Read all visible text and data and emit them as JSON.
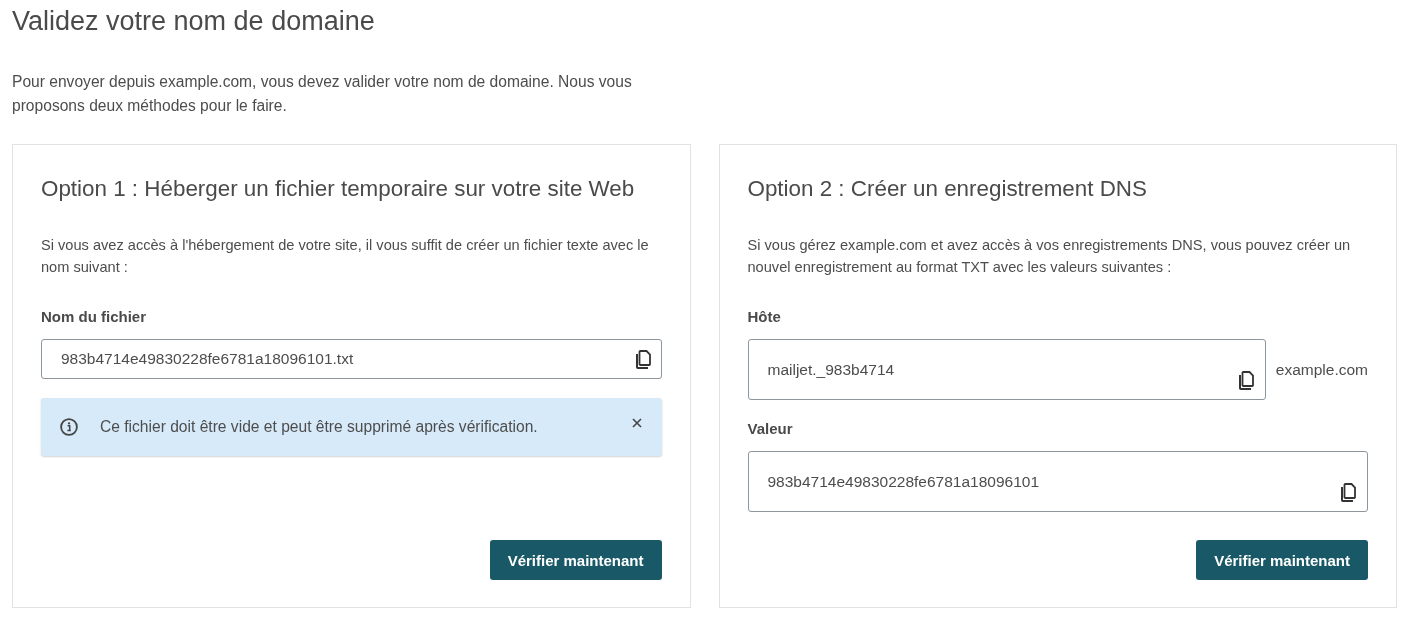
{
  "page": {
    "title": "Validez votre nom de domaine",
    "intro": "Pour envoyer depuis example.com, vous devez valider votre nom de domaine. Nous vous proposons deux méthodes pour le faire."
  },
  "options": [
    {
      "title": "Option 1 : Héberger un fichier temporaire sur votre site Web",
      "description": "Si vous avez accès à l'hébergement de votre site, il vous suffit de créer un fichier texte avec le nom suivant :",
      "fields": [
        {
          "kind": "input",
          "label": "Nom du fichier",
          "value": "983b4714e49830228fe6781a18096101.txt"
        }
      ],
      "alert": {
        "kind": "info",
        "text": "Ce fichier doit être vide et peut être supprimé après vérification.",
        "dismissible": true
      },
      "button": "Vérifier maintenant"
    },
    {
      "title": "Option 2 : Créer un enregistrement DNS",
      "description": "Si vous gérez example.com et avez accès à vos enregistrements DNS, vous pouvez créer un nouvel enregistrement au format TXT avec les valeurs suivantes :",
      "fields": [
        {
          "kind": "textarea",
          "label": "Hôte",
          "value": "mailjet._983b4714",
          "suffix": "example.com"
        },
        {
          "kind": "textarea",
          "label": "Valeur",
          "value": "983b4714e49830228fe6781a18096101"
        }
      ],
      "button": "Vérifier maintenant"
    }
  ]
}
